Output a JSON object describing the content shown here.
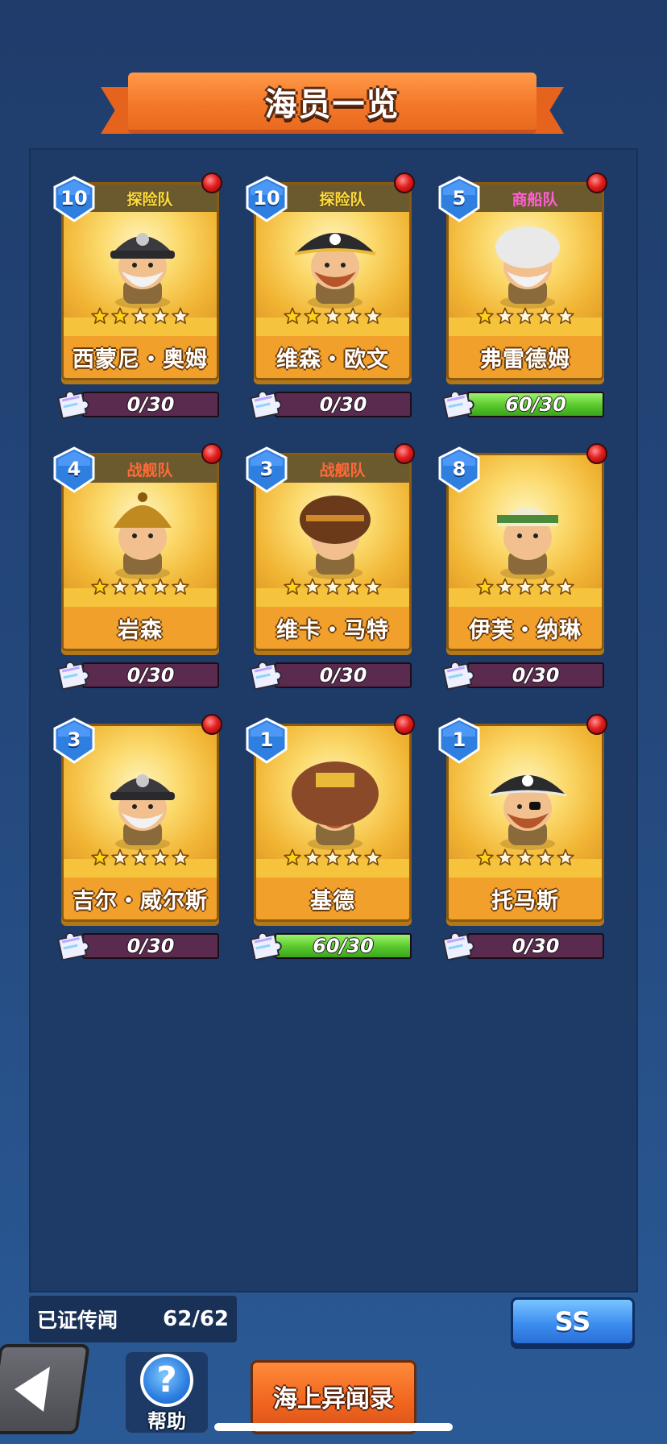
{
  "header": {
    "title": "海员一览"
  },
  "crew": [
    {
      "level": "10",
      "team": "探险队",
      "team_color": "yellow",
      "name": "西蒙尼・奥姆",
      "stars": 2,
      "max_stars": 5,
      "fragments": "0/30",
      "fragment_progress": 0,
      "portrait_icon": "old-sailor-hat-icon",
      "alert": true
    },
    {
      "level": "10",
      "team": "探险队",
      "team_color": "yellow",
      "name": "维森・欧文",
      "stars": 2,
      "max_stars": 5,
      "fragments": "0/30",
      "fragment_progress": 0,
      "portrait_icon": "pirate-captain-icon",
      "alert": true
    },
    {
      "level": "5",
      "team": "商船队",
      "team_color": "pink",
      "name": "弗雷德姆",
      "stars": 1,
      "max_stars": 5,
      "fragments": "60/30",
      "fragment_progress": 1,
      "portrait_icon": "old-merchant-icon",
      "alert": true
    },
    {
      "level": "4",
      "team": "战舰队",
      "team_color": "red",
      "name": "岩森",
      "stars": 1,
      "max_stars": 5,
      "fragments": "0/30",
      "fragment_progress": 0,
      "portrait_icon": "samurai-helmet-icon",
      "alert": true
    },
    {
      "level": "3",
      "team": "战舰队",
      "team_color": "red",
      "name": "维卡・马特",
      "stars": 1,
      "max_stars": 5,
      "fragments": "0/30",
      "fragment_progress": 0,
      "portrait_icon": "curly-hair-warrior-icon",
      "alert": true
    },
    {
      "level": "8",
      "team": "",
      "team_color": "yellow",
      "name": "伊芙・纳琳",
      "stars": 1,
      "max_stars": 5,
      "fragments": "0/30",
      "fragment_progress": 0,
      "portrait_icon": "desert-explorer-icon",
      "alert": true
    },
    {
      "level": "3",
      "team": "",
      "team_color": "yellow",
      "name": "吉尔・威尔斯",
      "stars": 1,
      "max_stars": 5,
      "fragments": "0/30",
      "fragment_progress": 0,
      "portrait_icon": "old-sailor-hat-icon",
      "alert": true
    },
    {
      "level": "1",
      "team": "",
      "team_color": "yellow",
      "name": "基德",
      "stars": 1,
      "max_stars": 5,
      "fragments": "60/30",
      "fragment_progress": 1,
      "portrait_icon": "viking-king-icon",
      "alert": true
    },
    {
      "level": "1",
      "team": "",
      "team_color": "yellow",
      "name": "托马斯",
      "stars": 1,
      "max_stars": 5,
      "fragments": "0/30",
      "fragment_progress": 0,
      "portrait_icon": "eyepatch-pirate-icon",
      "alert": true
    }
  ],
  "footer": {
    "verified_label": "已证传闻",
    "verified_count": "62/62",
    "ss_label": "SS",
    "help_label": "帮助",
    "help_symbol": "?",
    "sea_tales_label": "海上异闻录"
  },
  "colors": {
    "card_gold": "#f6c33c",
    "team_yellow": "#ffdc3c",
    "team_red": "#ff6a38",
    "team_pink": "#ff5fd4",
    "progress_green": "#58c72b",
    "progress_empty": "#5a2b4e",
    "level_badge_blue": "#2f7fe0"
  }
}
